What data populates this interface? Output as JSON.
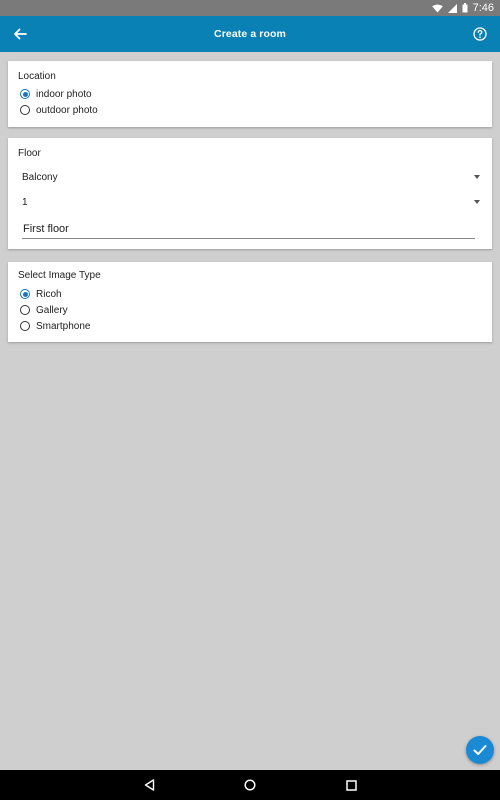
{
  "status_bar": {
    "time": "7:46"
  },
  "app_bar": {
    "title": "Create a room",
    "back_icon": "arrow-left-icon",
    "help_icon": "help-circle-icon",
    "color": "#0a81b5"
  },
  "location": {
    "label": "Location",
    "options": [
      {
        "label": "indoor photo",
        "selected": true
      },
      {
        "label": "outdoor photo",
        "selected": false
      }
    ]
  },
  "floor": {
    "label": "Floor",
    "dropdown_1": "Balcony",
    "dropdown_2": "1",
    "text_value": "First floor"
  },
  "image_type": {
    "label": "Select Image Type",
    "options": [
      {
        "label": "Ricoh",
        "selected": true
      },
      {
        "label": "Gallery",
        "selected": false
      },
      {
        "label": "Smartphone",
        "selected": false
      }
    ]
  },
  "fab": {
    "icon": "check-icon",
    "color": "#1a8ad4"
  },
  "nav_bar": {
    "icons": [
      "back-triangle-icon",
      "home-circle-icon",
      "recents-square-icon"
    ]
  }
}
